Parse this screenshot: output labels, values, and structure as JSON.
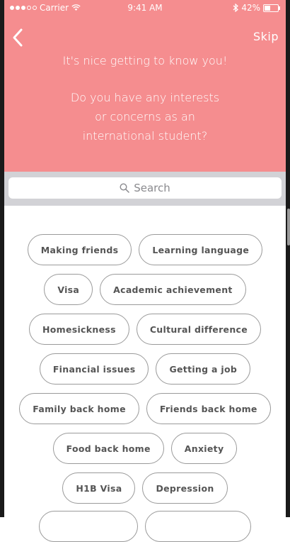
{
  "status": {
    "carrier": "Carrier",
    "time": "9:41 AM",
    "battery": "42%",
    "battery_level": 0.42
  },
  "header": {
    "skip_label": "Skip",
    "greeting": "It's nice getting to know you!",
    "question": "Do you have any interests\nor concerns as an\ninternational student?"
  },
  "search": {
    "placeholder": "Search"
  },
  "tags": [
    [
      "Making friends",
      "Learning language"
    ],
    [
      "Visa",
      "Academic achievement"
    ],
    [
      "Homesickness",
      "Cultural difference"
    ],
    [
      "Financial issues",
      "Getting a job"
    ],
    [
      "Family back home",
      "Friends back home"
    ],
    [
      "Food back home",
      "Anxiety"
    ],
    [
      "H1B Visa",
      "Depression"
    ]
  ],
  "colors": {
    "header_bg": "#f58d8f",
    "tag_border": "#9a9a9a"
  }
}
